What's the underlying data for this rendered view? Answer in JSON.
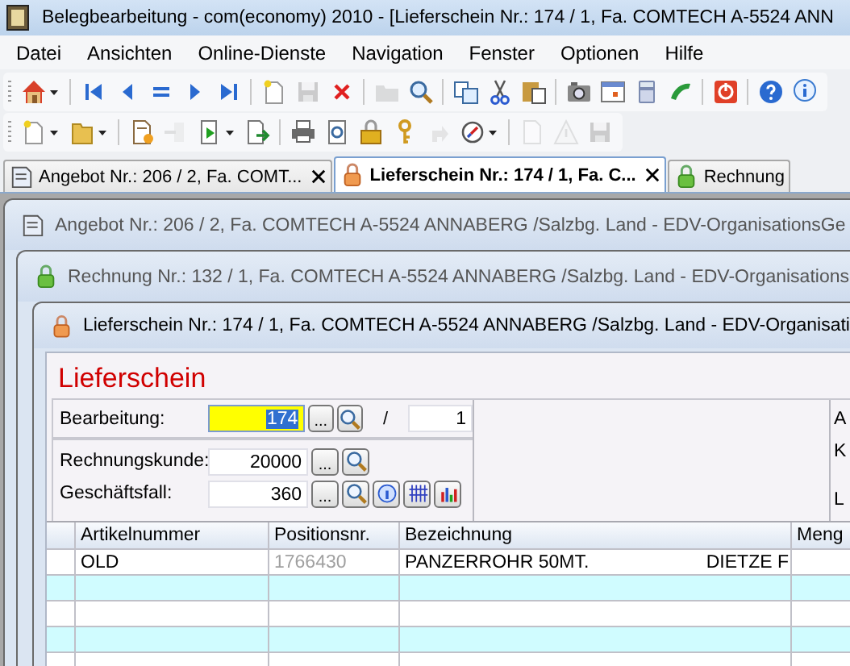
{
  "window": {
    "title": "Belegbearbeitung - com(economy) 2010 - [Lieferschein Nr.: 174 / 1, Fa. COMTECH A-5524 ANN"
  },
  "menu": [
    "Datei",
    "Ansichten",
    "Online-Dienste",
    "Navigation",
    "Fenster",
    "Optionen",
    "Hilfe"
  ],
  "toolbars": [
    [
      {
        "kind": "home",
        "disabled": false,
        "dropdown": true
      },
      {
        "kind": "separator"
      },
      {
        "kind": "first",
        "disabled": false,
        "dropdown": false
      },
      {
        "kind": "prev",
        "disabled": false,
        "dropdown": false
      },
      {
        "kind": "equals",
        "disabled": false,
        "dropdown": false
      },
      {
        "kind": "next",
        "disabled": false,
        "dropdown": false
      },
      {
        "kind": "last",
        "disabled": false,
        "dropdown": false
      },
      {
        "kind": "separator"
      },
      {
        "kind": "new",
        "disabled": false,
        "dropdown": false
      },
      {
        "kind": "save",
        "disabled": true,
        "dropdown": false
      },
      {
        "kind": "delete",
        "disabled": false,
        "dropdown": false
      },
      {
        "kind": "separator"
      },
      {
        "kind": "open",
        "disabled": true,
        "dropdown": false
      },
      {
        "kind": "search",
        "disabled": false,
        "dropdown": false
      },
      {
        "kind": "separator"
      },
      {
        "kind": "copy",
        "disabled": false,
        "dropdown": false
      },
      {
        "kind": "cut",
        "disabled": false,
        "dropdown": false
      },
      {
        "kind": "paste",
        "disabled": false,
        "dropdown": false
      },
      {
        "kind": "separator"
      },
      {
        "kind": "camera",
        "disabled": false,
        "dropdown": false
      },
      {
        "kind": "calendar",
        "disabled": false,
        "dropdown": false
      },
      {
        "kind": "calculator",
        "disabled": false,
        "dropdown": false
      },
      {
        "kind": "phone",
        "disabled": false,
        "dropdown": false
      },
      {
        "kind": "separator"
      },
      {
        "kind": "power",
        "disabled": false,
        "dropdown": false
      },
      {
        "kind": "separator"
      },
      {
        "kind": "help",
        "disabled": false,
        "dropdown": false
      },
      {
        "kind": "info",
        "disabled": false,
        "dropdown": false
      }
    ],
    [
      {
        "kind": "new",
        "disabled": false,
        "dropdown": true
      },
      {
        "kind": "folder",
        "disabled": false,
        "dropdown": true
      },
      {
        "kind": "separator"
      },
      {
        "kind": "newstar",
        "disabled": false,
        "dropdown": false
      },
      {
        "kind": "import",
        "disabled": true,
        "dropdown": false
      },
      {
        "kind": "play",
        "disabled": false,
        "dropdown": true
      },
      {
        "kind": "export",
        "disabled": false,
        "dropdown": false
      },
      {
        "kind": "separator"
      },
      {
        "kind": "print",
        "disabled": false,
        "dropdown": false
      },
      {
        "kind": "preview",
        "disabled": false,
        "dropdown": false
      },
      {
        "kind": "lock",
        "disabled": false,
        "dropdown": false
      },
      {
        "kind": "key",
        "disabled": false,
        "dropdown": false
      },
      {
        "kind": "redo",
        "disabled": true,
        "dropdown": false
      },
      {
        "kind": "compass",
        "disabled": false,
        "dropdown": true
      },
      {
        "kind": "separator"
      },
      {
        "kind": "doc",
        "disabled": true,
        "dropdown": false
      },
      {
        "kind": "warning",
        "disabled": true,
        "dropdown": false
      },
      {
        "kind": "save",
        "disabled": true,
        "dropdown": false
      }
    ]
  ],
  "tabs": [
    {
      "label": "Angebot Nr.: 206 / 2, Fa. COMT...",
      "selected": false,
      "closable": true
    },
    {
      "label": "Lieferschein Nr.: 174 / 1, Fa. C...",
      "selected": true,
      "closable": true
    },
    {
      "label": "Rechnung",
      "selected": false,
      "closable": false
    }
  ],
  "mdi_windows": [
    {
      "title": "Angebot Nr.: 206 / 2, Fa. COMTECH A-5524 ANNABERG /Salzbg. Land  - EDV-OrganisationsGe",
      "active": false
    },
    {
      "title": "Rechnung Nr.: 132 / 1, Fa. COMTECH A-5524 ANNABERG /Salzbg. Land  - EDV-Organisations",
      "active": false
    },
    {
      "title": "Lieferschein Nr.: 174 / 1, Fa. COMTECH A-5524 ANNABERG /Salzbg. Land  - EDV-Organisati",
      "active": true
    }
  ],
  "form": {
    "heading": "Lieferschein",
    "browse_label": "...",
    "fields": [
      {
        "kind": "number_pair",
        "label": "Bearbeitung:",
        "value": "174",
        "focused": true,
        "separator": "/",
        "second_value": "1"
      },
      {
        "kind": "lookup",
        "label": "Rechnungskunde:",
        "value": "20000",
        "focused": false
      },
      {
        "kind": "lookup_tools",
        "label": "Geschäftsfall:",
        "value": "360",
        "focused": false
      }
    ],
    "side_labels": [
      "A",
      "K",
      "L"
    ]
  },
  "grid": {
    "columns": [
      "Artikelnummer",
      "Positionsnr.",
      "Bezeichnung",
      "Meng"
    ],
    "rows": [
      {
        "artikelnummer": "OLD",
        "positionsnr": "1766430",
        "bezeichnung": "PANZERROHR 50MT.",
        "bezeichnung_suffix": "DIETZE F"
      }
    ]
  }
}
